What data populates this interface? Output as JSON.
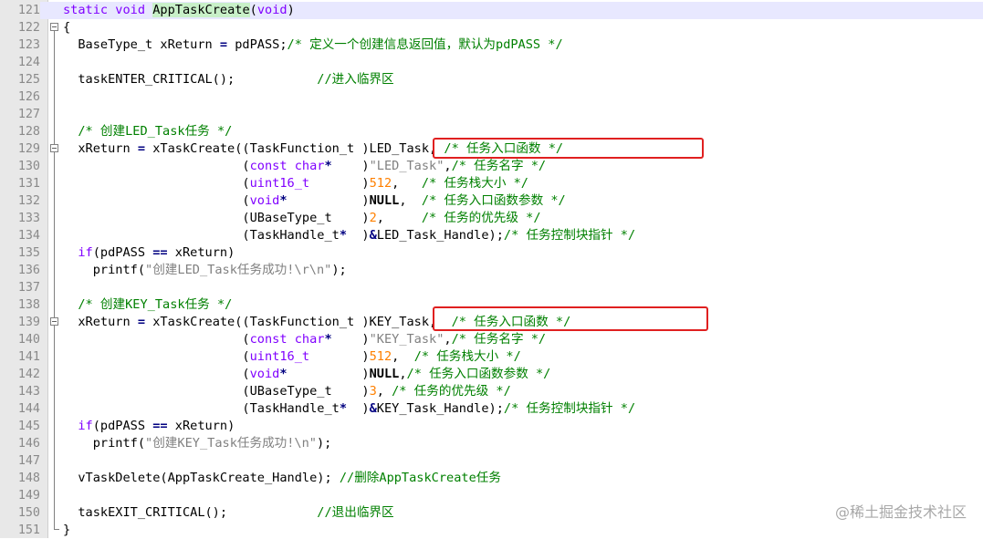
{
  "editor": {
    "lines": [
      {
        "n": "121",
        "text": "static void AppTaskCreate(void)"
      },
      {
        "n": "122",
        "text": "{"
      },
      {
        "n": "123",
        "text": "  BaseType_t xReturn = pdPASS;/* 定义一个创建信息返回值，默认为pdPASS */"
      },
      {
        "n": "124",
        "text": ""
      },
      {
        "n": "125",
        "text": "  taskENTER_CRITICAL();           //进入临界区"
      },
      {
        "n": "126",
        "text": ""
      },
      {
        "n": "127",
        "text": ""
      },
      {
        "n": "128",
        "text": "  /* 创建LED_Task任务 */"
      },
      {
        "n": "129",
        "text": "  xReturn = xTaskCreate((TaskFunction_t )LED_Task, /* 任务入口函数 */"
      },
      {
        "n": "130",
        "text": "                        (const char*    )\"LED_Task\",/* 任务名字 */"
      },
      {
        "n": "131",
        "text": "                        (uint16_t       )512,   /* 任务栈大小 */"
      },
      {
        "n": "132",
        "text": "                        (void*          )NULL,  /* 任务入口函数参数 */"
      },
      {
        "n": "133",
        "text": "                        (UBaseType_t    )2,     /* 任务的优先级 */"
      },
      {
        "n": "134",
        "text": "                        (TaskHandle_t*  )&LED_Task_Handle);/* 任务控制块指针 */"
      },
      {
        "n": "135",
        "text": "  if(pdPASS == xReturn)"
      },
      {
        "n": "136",
        "text": "    printf(\"创建LED_Task任务成功!\\r\\n\");"
      },
      {
        "n": "137",
        "text": ""
      },
      {
        "n": "138",
        "text": "  /* 创建KEY_Task任务 */"
      },
      {
        "n": "139",
        "text": "  xReturn = xTaskCreate((TaskFunction_t )KEY_Task,  /* 任务入口函数 */"
      },
      {
        "n": "140",
        "text": "                        (const char*    )\"KEY_Task\",/* 任务名字 */"
      },
      {
        "n": "141",
        "text": "                        (uint16_t       )512,  /* 任务栈大小 */"
      },
      {
        "n": "142",
        "text": "                        (void*          )NULL,/* 任务入口函数参数 */"
      },
      {
        "n": "143",
        "text": "                        (UBaseType_t    )3, /* 任务的优先级 */"
      },
      {
        "n": "144",
        "text": "                        (TaskHandle_t*  )&KEY_Task_Handle);/* 任务控制块指针 */"
      },
      {
        "n": "145",
        "text": "  if(pdPASS == xReturn)"
      },
      {
        "n": "146",
        "text": "    printf(\"创建KEY_Task任务成功!\\n\");"
      },
      {
        "n": "147",
        "text": ""
      },
      {
        "n": "148",
        "text": "  vTaskDelete(AppTaskCreate_Handle); //删除AppTaskCreate任务"
      },
      {
        "n": "149",
        "text": ""
      },
      {
        "n": "150",
        "text": "  taskEXIT_CRITICAL();            //退出临界区"
      },
      {
        "n": "151",
        "text": "}"
      }
    ]
  },
  "watermark": "@稀土掘金技术社区",
  "colors": {
    "keyword": "#8000ff",
    "comment": "#008000",
    "string": "#808080",
    "number": "#ff8000",
    "highlight_box": "#e02020",
    "function_highlight": "#c8f0c8"
  }
}
